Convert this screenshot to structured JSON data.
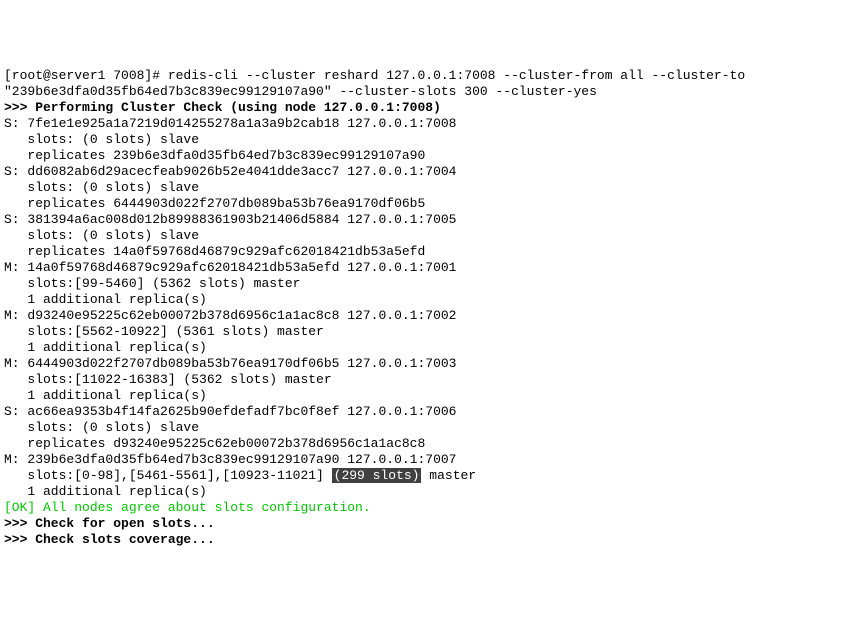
{
  "prompt": "[root@server1 7008]# redis-cli --cluster reshard 127.0.0.1:7008 --cluster-from all --cluster-to",
  "prompt2": "\"239b6e3dfa0d35fb64ed7b3c839ec99129107a90\" --cluster-slots 300 --cluster-yes",
  "header": ">>> Performing Cluster Check (using node 127.0.0.1:7008)",
  "nodes": [
    {
      "type": "S:",
      "id": "7fe1e1e925a1a7219d014255278a1a3a9b2cab18",
      "addr": "127.0.0.1:7008",
      "slots": "   slots: (0 slots) slave",
      "rep": "   replicates 239b6e3dfa0d35fb64ed7b3c839ec99129107a90"
    },
    {
      "type": "S:",
      "id": "dd6082ab6d29acecfeab9026b52e4041dde3acc7",
      "addr": "127.0.0.1:7004",
      "slots": "   slots: (0 slots) slave",
      "rep": "   replicates 6444903d022f2707db089ba53b76ea9170df06b5"
    },
    {
      "type": "S:",
      "id": "381394a6ac008d012b89988361903b21406d5884",
      "addr": "127.0.0.1:7005",
      "slots": "   slots: (0 slots) slave",
      "rep": "   replicates 14a0f59768d46879c929afc62018421db53a5efd"
    },
    {
      "type": "M:",
      "id": "14a0f59768d46879c929afc62018421db53a5efd",
      "addr": "127.0.0.1:7001",
      "slots": "   slots:[99-5460] (5362 slots) master",
      "rep": "   1 additional replica(s)"
    },
    {
      "type": "M:",
      "id": "d93240e95225c62eb00072b378d6956c1a1ac8c8",
      "addr": "127.0.0.1:7002",
      "slots": "   slots:[5562-10922] (5361 slots) master",
      "rep": "   1 additional replica(s)"
    },
    {
      "type": "M:",
      "id": "6444903d022f2707db089ba53b76ea9170df06b5",
      "addr": "127.0.0.1:7003",
      "slots": "   slots:[11022-16383] (5362 slots) master",
      "rep": "   1 additional replica(s)"
    },
    {
      "type": "S:",
      "id": "ac66ea9353b4f14fa2625b90efdefadf7bc0f8ef",
      "addr": "127.0.0.1:7006",
      "slots": "   slots: (0 slots) slave",
      "rep": "   replicates d93240e95225c62eb00072b378d6956c1a1ac8c8"
    }
  ],
  "last_m": "M: 239b6e3dfa0d35fb64ed7b3c839ec99129107a90 127.0.0.1:7007",
  "last_slots_prefix": "   slots:[0-98],[5461-5561],[10923-11021] ",
  "last_slots_highlight": "(299 slots)",
  "last_slots_suffix": " master",
  "last_rep": "   1 additional replica(s)",
  "ok_line": "[OK] All nodes agree about slots configuration.",
  "check_open": ">>> Check for open slots...",
  "check_cov": ">>> Check slots coverage..."
}
